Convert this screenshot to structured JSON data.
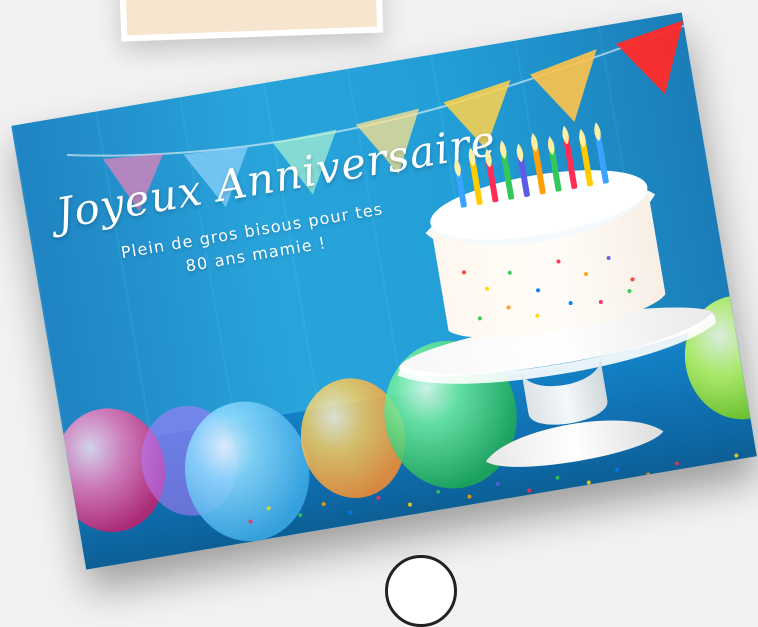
{
  "card": {
    "title": "Joyeux Anniversaire",
    "subtitle_line1": "Plein de gros bisous pour tes",
    "subtitle_line2": "80 ans mamie !"
  },
  "colors": {
    "background": "#f2f2f2",
    "card_blue": "#23a1db",
    "text": "#ffffff"
  },
  "icons": {
    "bottom_control": "circle-icon"
  }
}
